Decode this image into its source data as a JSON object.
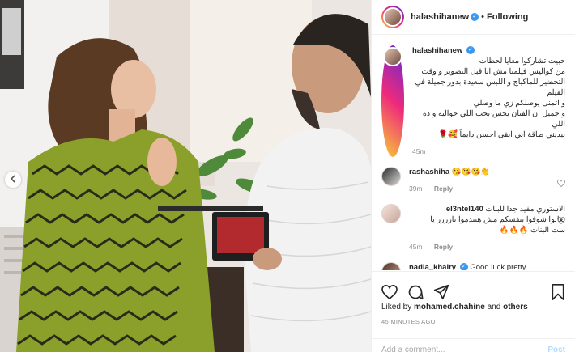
{
  "post": {
    "username": "halashihanew",
    "following_label": "Following",
    "caption_lines": [
      "حبيت تشاركوا معايا لحظات",
      "من كواليس فيلمنا مش انا قبل التصوير و وقت",
      "التحضير للماكياج و اللبس سعيدة بدور جميلة في الفيلم",
      "و اتمنى يوصلكم زي ما وصلي",
      "و جميل ان الفنان يحس بحب اللي حواليه و ده اللي",
      "بيديني طاقة ابي ابقى احسن دايماً 🥰🌹"
    ],
    "caption_time": "45m",
    "likes_prefix": "Liked by",
    "likes_user": "mohamed.chahine",
    "likes_and": "and",
    "likes_others": "others",
    "time_ago": "45 MINUTES AGO",
    "add_comment_placeholder": "Add a comment...",
    "post_label": "Post"
  },
  "comments": [
    {
      "username": "rashashiha",
      "text": "😘😘😘👏",
      "time": "39m",
      "reply": "Reply"
    },
    {
      "username": "el3ntel140",
      "text": "الاستوري مفيد جدا للبنات",
      "text2": "تعالوا شوفوا بنفسكم مش هتندموا نارررر يا",
      "text3": "ست البنات 🔥🔥🔥",
      "time": "45m",
      "reply": "Reply"
    },
    {
      "username": "nadia_khairy",
      "text": "Good luck pretty"
    }
  ],
  "icons": {
    "verified": "verified-badge-icon",
    "like": "heart-icon",
    "comment": "comment-bubble-icon",
    "share": "paper-plane-icon",
    "save": "bookmark-icon",
    "prev": "chevron-left-icon"
  },
  "colors": {
    "verified": "#3897f0",
    "link": "#b3dbff",
    "muted": "#8e8e8e"
  }
}
